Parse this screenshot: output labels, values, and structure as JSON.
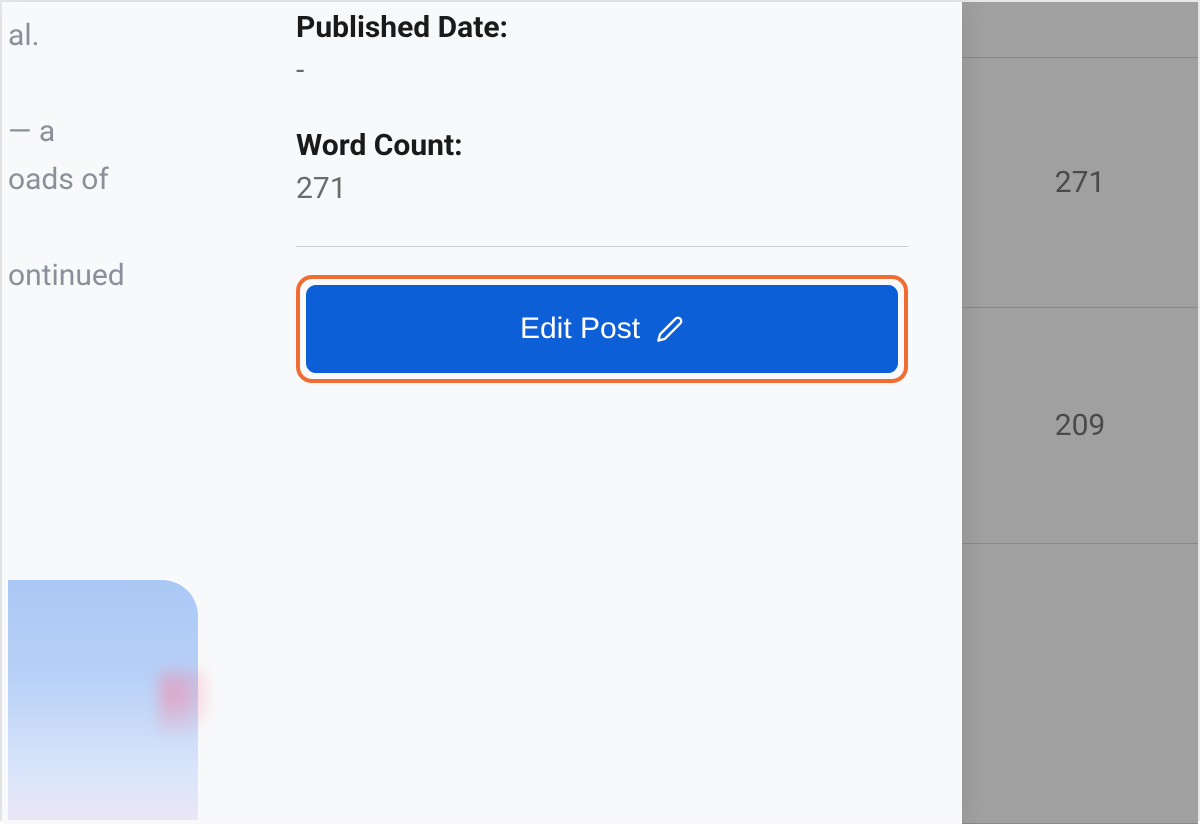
{
  "leftColumn": {
    "line1": "al.",
    "line2a": " — a",
    "line2b": "oads of",
    "line3": "ontinued"
  },
  "details": {
    "publishedLabel": "Published Date:",
    "publishedValue": "-",
    "wordCountLabel": "Word Count:",
    "wordCountValue": "271"
  },
  "actions": {
    "editPost": "Edit Post"
  },
  "background": {
    "row1": "271",
    "row2": "209",
    "row3": ""
  }
}
